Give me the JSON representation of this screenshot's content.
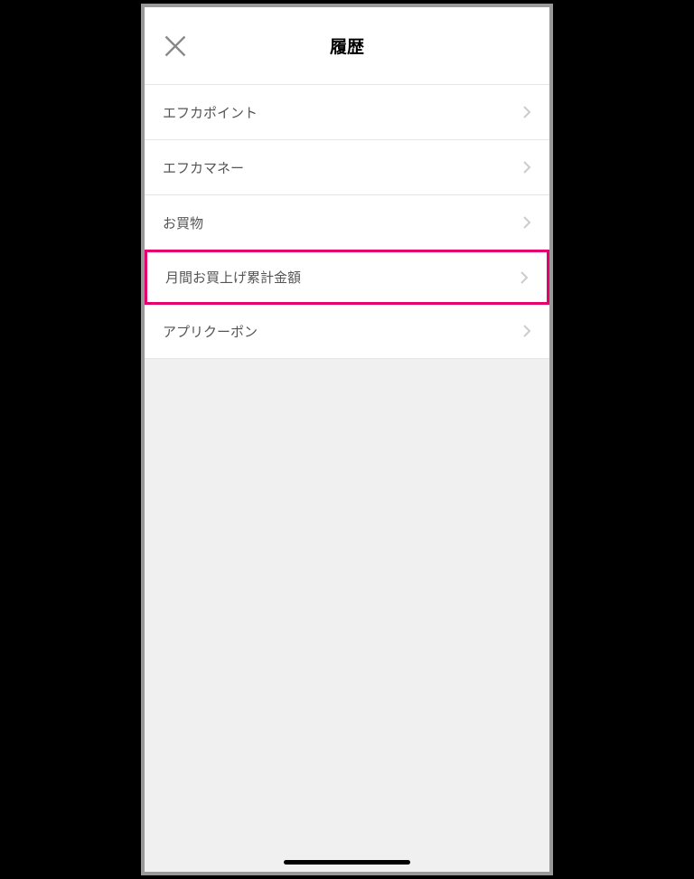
{
  "header": {
    "title": "履歴"
  },
  "list": {
    "items": [
      {
        "label": "エフカポイント",
        "highlighted": false
      },
      {
        "label": "エフカマネー",
        "highlighted": false
      },
      {
        "label": "お買物",
        "highlighted": false
      },
      {
        "label": "月間お買上げ累計金額",
        "highlighted": true
      },
      {
        "label": "アプリクーポン",
        "highlighted": false
      }
    ]
  }
}
